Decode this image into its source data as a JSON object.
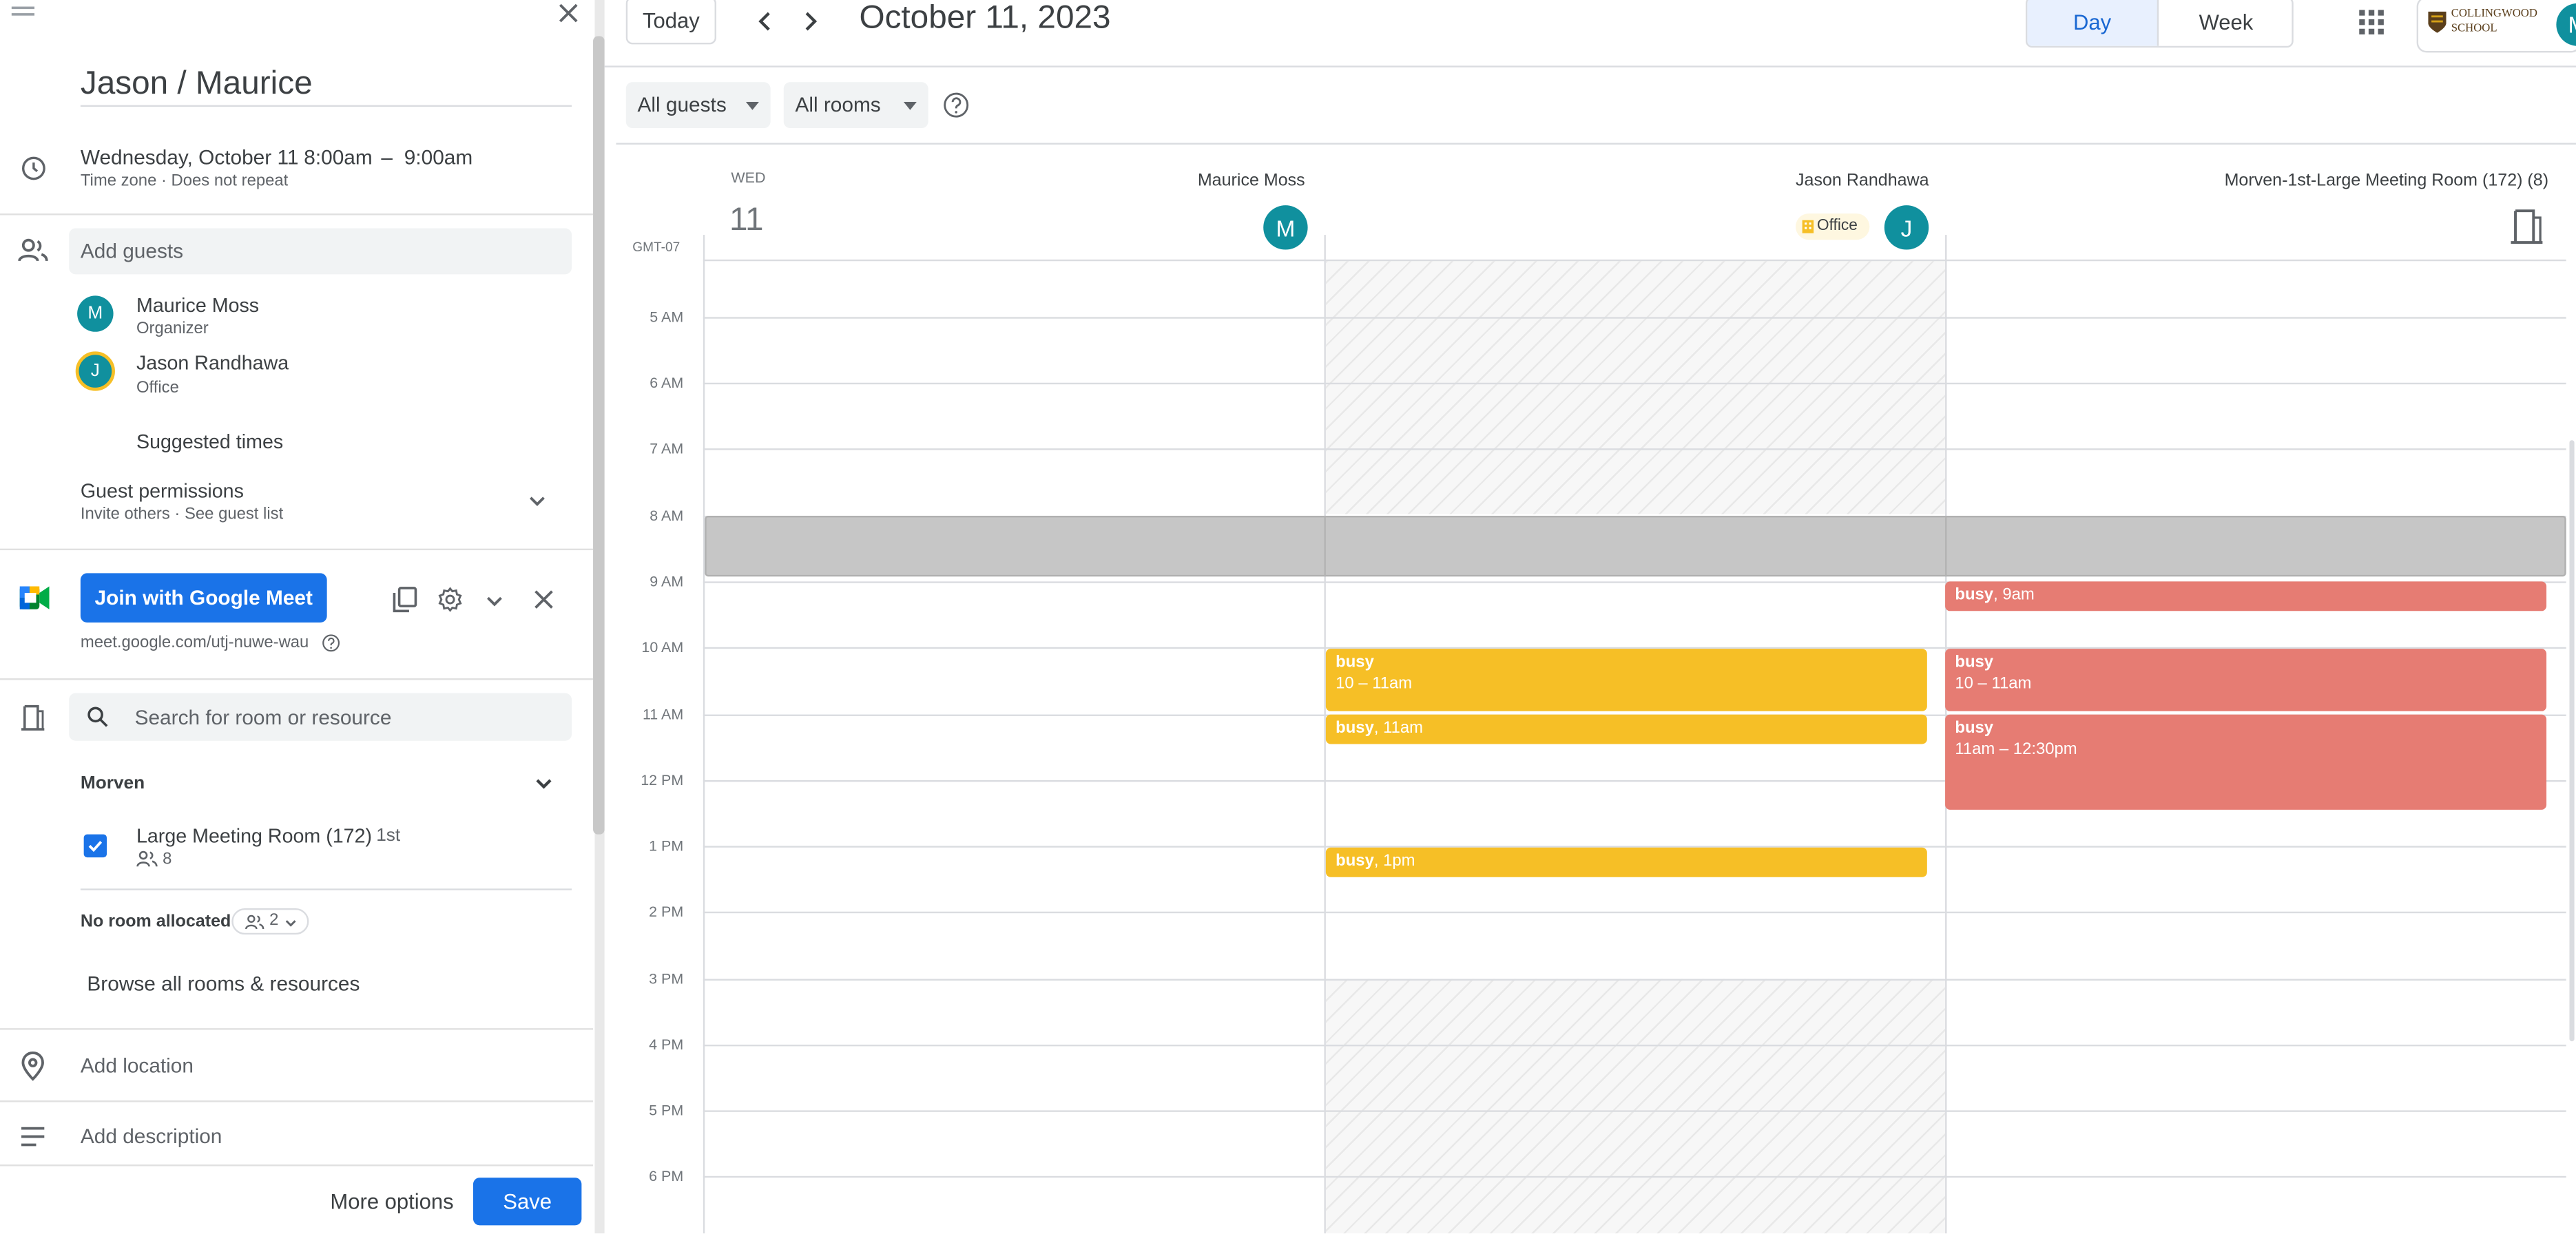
{
  "event": {
    "title": "Jason / Maurice",
    "date": "Wednesday, October 11",
    "start_time": "8:00am",
    "time_sep": "–",
    "end_time": "9:00am",
    "timezone_line": "Time zone · Does not repeat"
  },
  "guests": {
    "add_placeholder": "Add guests",
    "list": [
      {
        "initial": "M",
        "name": "Maurice Moss",
        "sub": "Organizer"
      },
      {
        "initial": "J",
        "name": "Jason Randhawa",
        "sub": "Office"
      }
    ],
    "suggested_times": "Suggested times",
    "permissions_title": "Guest permissions",
    "permissions_sub": "Invite others · See guest list"
  },
  "meet": {
    "join_label": "Join with Google Meet",
    "link": "meet.google.com/utj-nuwe-wau"
  },
  "rooms": {
    "search_placeholder": "Search for room or resource",
    "building": "Morven",
    "room_name": "Large Meeting Room (172)",
    "room_floor": "1st",
    "room_capacity": "8",
    "no_room": "No room allocated",
    "no_room_count": "2",
    "browse_all": "Browse all rooms & resources"
  },
  "location_placeholder": "Add location",
  "description_placeholder": "Add description",
  "footer": {
    "more_options": "More options",
    "save": "Save"
  },
  "calendar": {
    "today_label": "Today",
    "date_title": "October 11, 2023",
    "views": [
      "Day",
      "Week"
    ],
    "active_view": "Day",
    "filters": {
      "guests": "All guests",
      "rooms": "All rooms"
    },
    "day_abbr": "WED",
    "day_num": "11",
    "timezone": "GMT-07",
    "org_text": [
      "COLLINGWOOD",
      "SCHOOL"
    ],
    "account_initial": "M",
    "columns": [
      {
        "name": "Maurice Moss",
        "initial": "M"
      },
      {
        "name": "Jason Randhawa",
        "initial": "J",
        "badge": "Office"
      },
      {
        "name": "Morven-1st-Large Meeting Room (172) (8)"
      }
    ],
    "hours": [
      "5 AM",
      "6 AM",
      "7 AM",
      "8 AM",
      "9 AM",
      "10 AM",
      "11 AM",
      "12 PM",
      "1 PM",
      "2 PM",
      "3 PM",
      "4 PM",
      "5 PM",
      "6 PM"
    ],
    "events_jason": [
      {
        "title": "busy",
        "time": "10 – 11am"
      },
      {
        "title": "busy",
        "time": "11am"
      },
      {
        "title": "busy",
        "time": "1pm"
      }
    ],
    "events_room": [
      {
        "title": "busy",
        "time": "9am"
      },
      {
        "title": "busy",
        "time": "10 – 11am"
      },
      {
        "title": "busy",
        "time": "11am – 12:30pm"
      }
    ]
  },
  "colors": {
    "primary": "#1a73e8",
    "avatar_teal": "#10909e",
    "busy_yellow": "#f6bf26",
    "busy_red": "#e67c73",
    "active_tab_bg": "#e8f0fe"
  }
}
